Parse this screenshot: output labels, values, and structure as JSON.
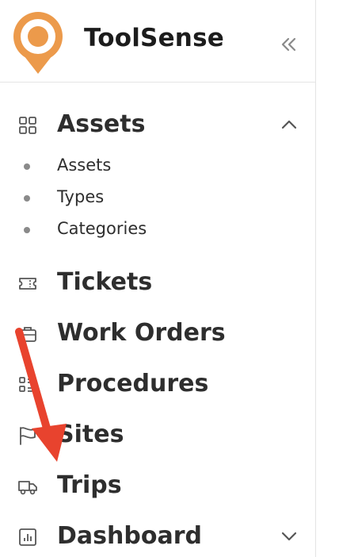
{
  "brand": {
    "name": "ToolSense",
    "accent": "#EC9A4B"
  },
  "sidebar": {
    "collapse_icon": "double-chevron-left-icon",
    "sections": [
      {
        "label": "Assets",
        "icon": "grid-icon",
        "expanded": true,
        "children": [
          {
            "label": "Assets"
          },
          {
            "label": "Types"
          },
          {
            "label": "Categories"
          }
        ]
      },
      {
        "label": "Tickets",
        "icon": "ticket-icon"
      },
      {
        "label": "Work Orders",
        "icon": "briefcase-icon"
      },
      {
        "label": "Procedures",
        "icon": "checklist-icon"
      },
      {
        "label": "Sites",
        "icon": "flag-icon"
      },
      {
        "label": "Trips",
        "icon": "truck-icon"
      },
      {
        "label": "Dashboard",
        "icon": "chart-icon",
        "expanded": false
      }
    ]
  },
  "annotation": {
    "color": "#E8432E"
  }
}
